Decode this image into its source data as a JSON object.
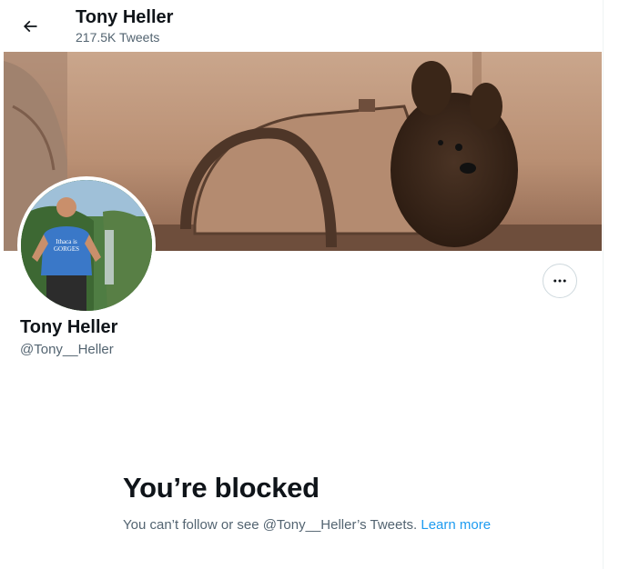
{
  "header": {
    "title": "Tony Heller",
    "tweet_count": "217.5K Tweets",
    "back_icon": "arrow-left-icon"
  },
  "banner": {
    "description_icon": "profile-banner-image"
  },
  "avatar": {
    "shirt_text_line1": "Ithaca is",
    "shirt_text_line2": "GORGES"
  },
  "profile": {
    "display_name": "Tony Heller",
    "handle": "@Tony__Heller",
    "more_icon": "more-horizontal-icon"
  },
  "blocked": {
    "title": "You’re blocked",
    "message": "You can’t follow or see @Tony__Heller’s Tweets. ",
    "learn_more": "Learn more"
  },
  "colors": {
    "accent": "#1d9bf0",
    "text_primary": "#0f1419",
    "text_secondary": "#536471",
    "border": "#cfd9de"
  }
}
